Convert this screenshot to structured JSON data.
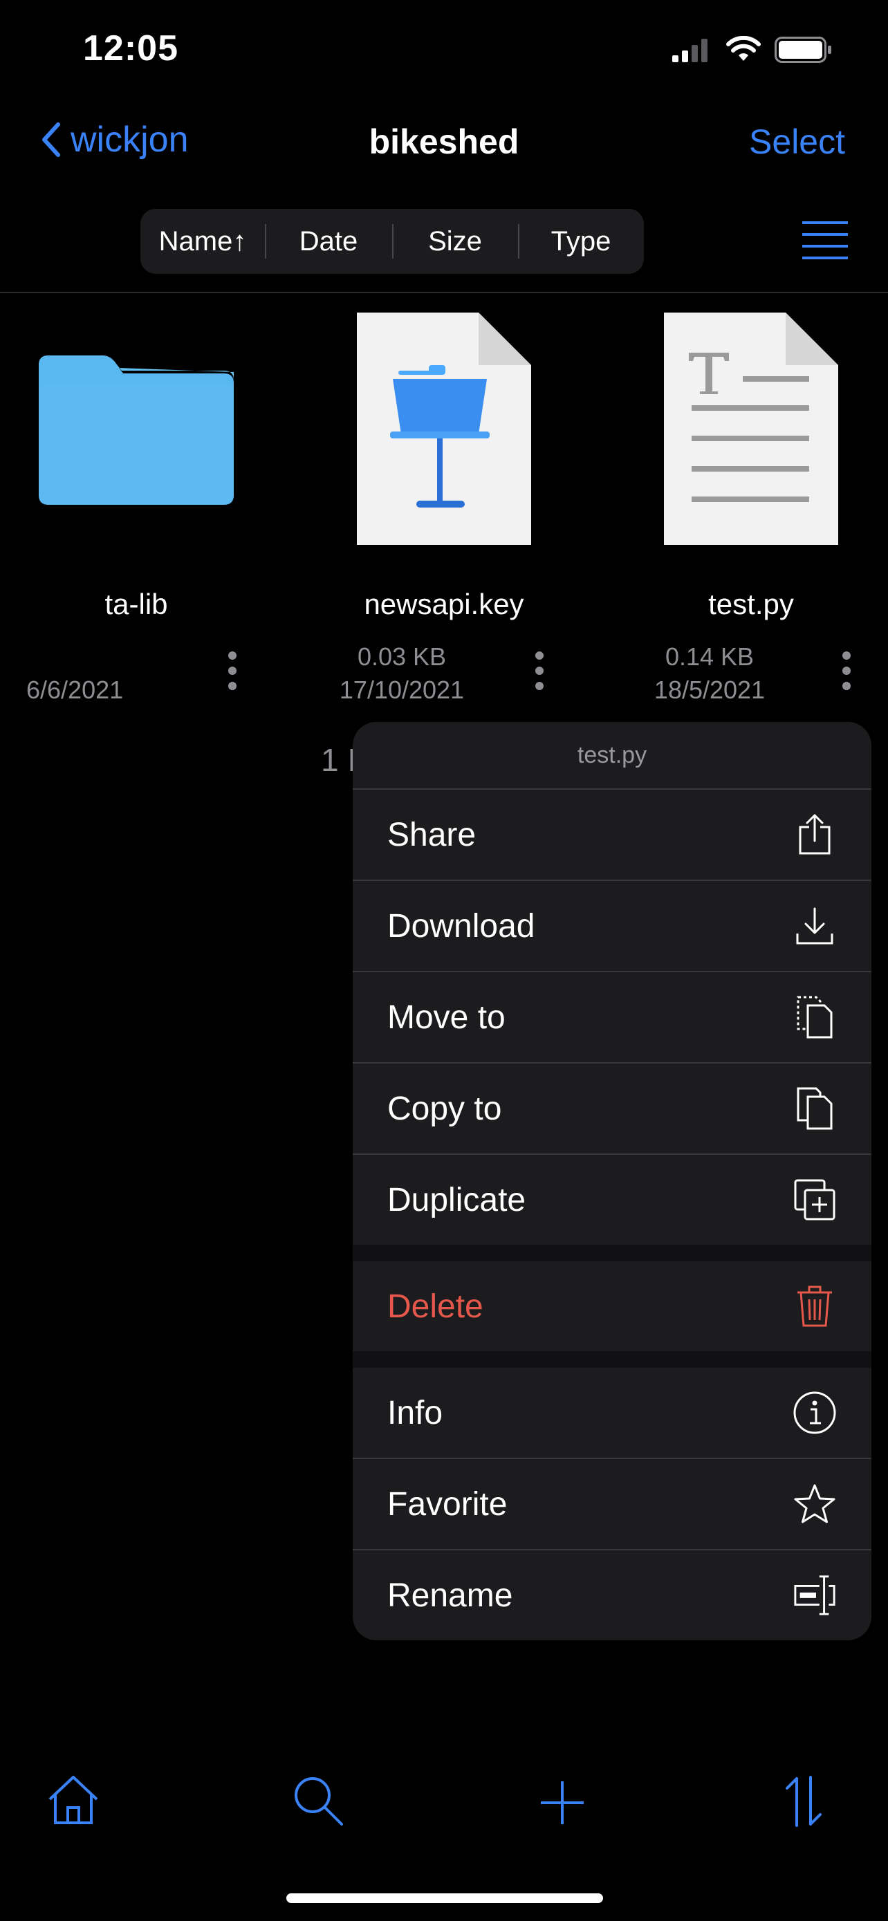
{
  "status_bar": {
    "time": "12:05"
  },
  "nav": {
    "back_label": "wickjon",
    "title": "bikeshed",
    "select_label": "Select"
  },
  "sort_bar": {
    "name": "Name↑",
    "date": "Date",
    "size": "Size",
    "type": "Type"
  },
  "files": [
    {
      "name": "ta-lib",
      "size": "",
      "date": "6/6/2021",
      "kind": "folder"
    },
    {
      "name": "newsapi.key",
      "size": "0.03 KB",
      "date": "17/10/2021",
      "kind": "keynote"
    },
    {
      "name": "test.py",
      "size": "0.14 KB",
      "date": "18/5/2021",
      "kind": "text"
    }
  ],
  "item_count": "1 I",
  "context_menu": {
    "title": "test.py",
    "items": [
      {
        "label": "Share",
        "icon": "share-icon"
      },
      {
        "label": "Download",
        "icon": "download-icon"
      },
      {
        "label": "Move to",
        "icon": "move-to-icon"
      },
      {
        "label": "Copy to",
        "icon": "copy-to-icon"
      },
      {
        "label": "Duplicate",
        "icon": "duplicate-icon"
      },
      {
        "label": "Delete",
        "icon": "trash-icon"
      },
      {
        "label": "Info",
        "icon": "info-icon"
      },
      {
        "label": "Favorite",
        "icon": "star-icon"
      },
      {
        "label": "Rename",
        "icon": "rename-icon"
      }
    ]
  },
  "tab_bar": {
    "icons": [
      "home-icon",
      "search-icon",
      "plus-icon",
      "sort-icon"
    ]
  },
  "colors": {
    "accent": "#3a82f7",
    "danger": "#e5584b",
    "folder": "#5ab8f0",
    "background": "#000000",
    "menu": "#1c1c1e"
  }
}
